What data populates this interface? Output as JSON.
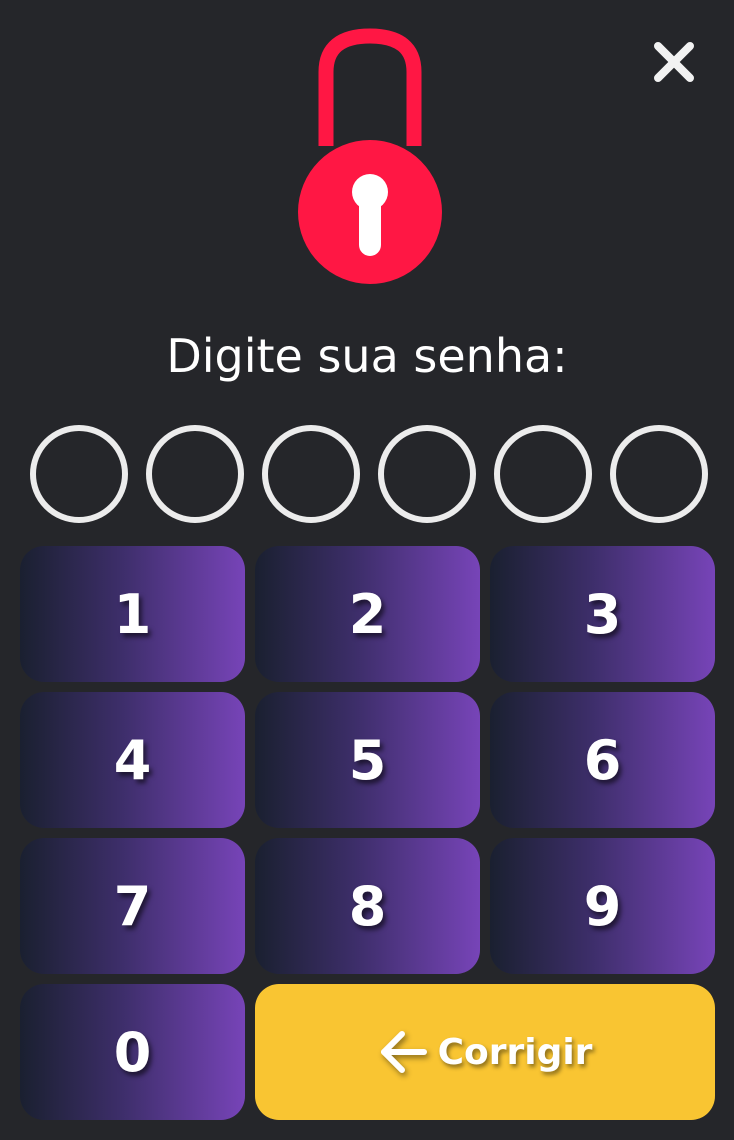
{
  "header": {
    "close_icon": "close-icon",
    "lock_icon": "padlock-icon"
  },
  "prompt": {
    "text": "Digite sua senha:"
  },
  "pin": {
    "length": 6,
    "filled": 0
  },
  "keypad": {
    "keys": [
      "1",
      "2",
      "3",
      "4",
      "5",
      "6",
      "7",
      "8",
      "9",
      "0"
    ],
    "correct_label": "Corrigir",
    "correct_icon": "arrow-left-icon"
  },
  "colors": {
    "background": "#25262a",
    "lock": "#ff1744",
    "key_gradient_start": "#1a2030",
    "key_gradient_end": "#7744b8",
    "correct_button": "#f9c532",
    "pin_ring": "#ececec"
  }
}
